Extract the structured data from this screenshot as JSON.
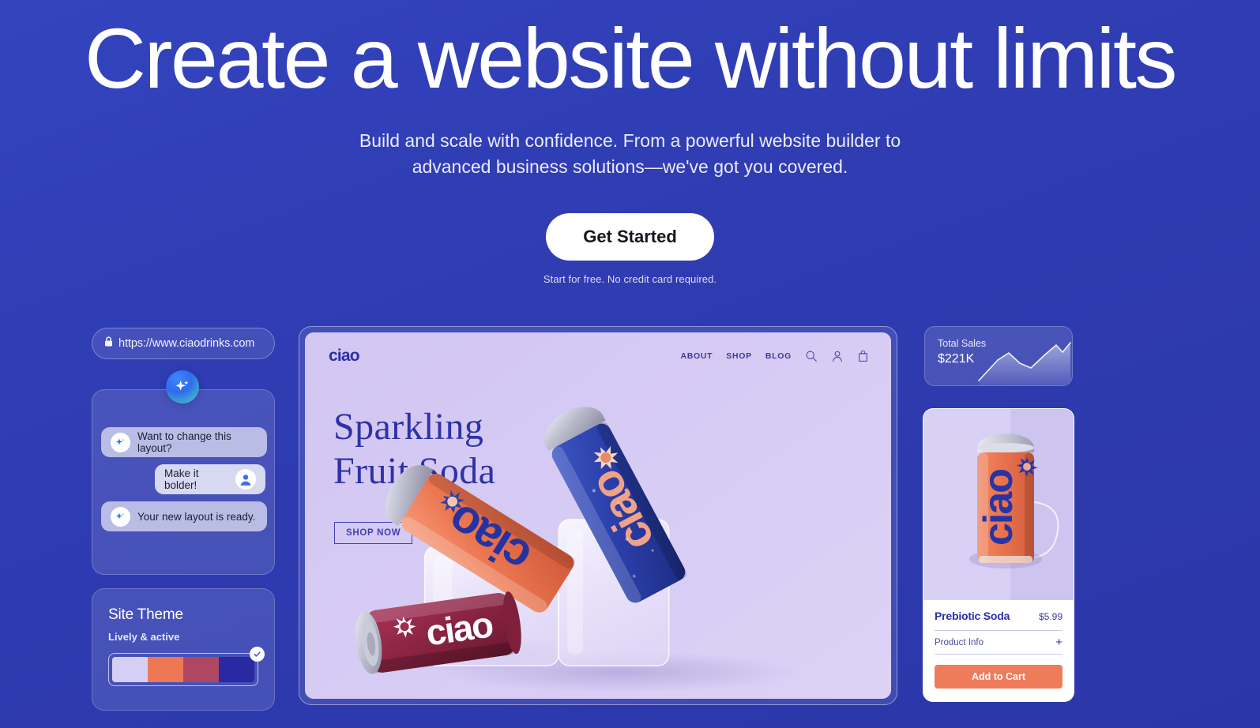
{
  "hero": {
    "title": "Create a website without limits",
    "subtitle_line1": "Build and scale with confidence. From a powerful website builder to",
    "subtitle_line2": "advanced business solutions—we've got you covered.",
    "cta_label": "Get Started",
    "cta_note": "Start for free. No credit card required."
  },
  "browser": {
    "lock_icon": "lock-icon",
    "url": "https://www.ciaodrinks.com"
  },
  "ai_chat": {
    "orb_icon": "sparkle-icon",
    "messages": [
      {
        "role": "assistant",
        "icon": "sparkle-icon",
        "text": "Want to change this layout?"
      },
      {
        "role": "user",
        "icon": "user-avatar-icon",
        "text": "Make it bolder!"
      },
      {
        "role": "assistant",
        "icon": "sparkle-icon",
        "text": "Your new layout is ready."
      }
    ]
  },
  "site_theme": {
    "title": "Site Theme",
    "subtitle": "Lively & active",
    "selected_check_icon": "check-icon",
    "swatches": [
      "#D6CEF5",
      "#EE7755",
      "#B04762",
      "#2929A3"
    ]
  },
  "site_preview": {
    "logo": "ciao",
    "nav_links": [
      "ABOUT",
      "SHOP",
      "BLOG"
    ],
    "nav_icons": [
      "search-icon",
      "account-icon",
      "bag-icon"
    ],
    "headline_line1": "Sparkling",
    "headline_line2": "Fruit Soda",
    "cta_label": "SHOP NOW",
    "brand_text": "ciao",
    "accent_colors": {
      "background": "#D6CBF4",
      "text": "#2E32A6",
      "can_orange": "#E8714E",
      "can_blue": "#2B40A8",
      "can_maroon": "#8C2344"
    }
  },
  "sales_card": {
    "label": "Total Sales",
    "value": "$221K",
    "chart_icon": "sparkline-chart"
  },
  "product_card": {
    "image_alt": "orange-ciao-can",
    "name": "Prebiotic Soda",
    "price": "$5.99",
    "info_label": "Product Info",
    "expand_icon": "plus-icon",
    "add_to_cart_label": "Add to Cart",
    "button_color": "#EE7B5A"
  },
  "page_colors": {
    "background_from": "#3344BE",
    "background_to": "#2B37A8",
    "accent_white": "#FFFFFF"
  }
}
